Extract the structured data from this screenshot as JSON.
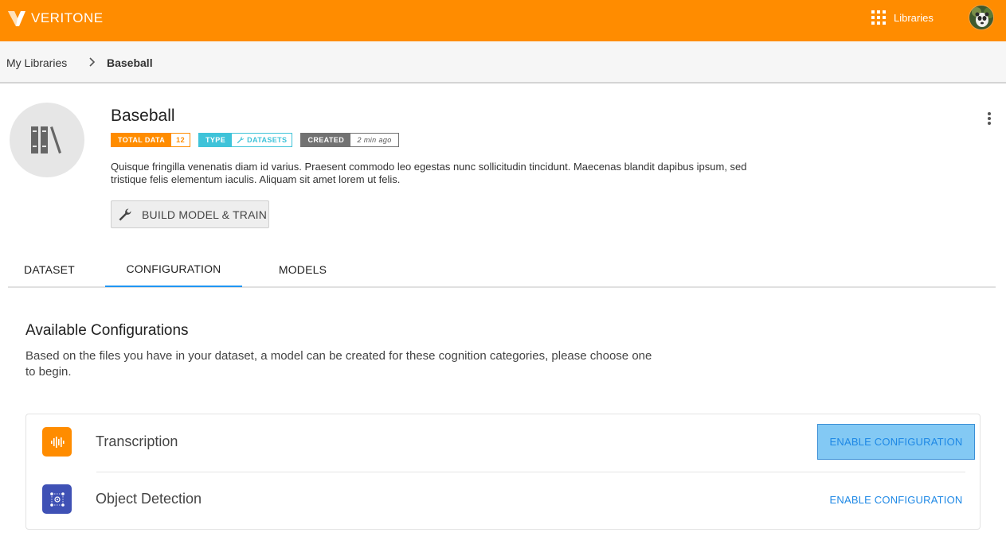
{
  "header": {
    "brand": "VERITONE",
    "apps_label": "Libraries",
    "icons": {
      "apps": "apps-grid-icon",
      "avatar": "user-avatar"
    }
  },
  "breadcrumb": {
    "root": "My Libraries",
    "current": "Baseball"
  },
  "library": {
    "title": "Baseball",
    "icon": "library-books-icon",
    "chips": {
      "total_data_key": "TOTAL DATA",
      "total_data_value": "12",
      "type_key": "TYPE",
      "type_value": "DATASETS",
      "created_key": "CREATED",
      "created_value": "2 min ago"
    },
    "description": "Quisque fringilla venenatis diam id varius. Praesent commodo leo egestas nunc sollicitudin tincidunt. Maecenas blandit dapibus ipsum, sed tristique felis elementum iaculis. Aliquam sit amet lorem ut felis.",
    "build_button": "BUILD MODEL & TRAIN"
  },
  "tabs": [
    {
      "label": "DATASET",
      "active": false
    },
    {
      "label": "CONFIGURATION",
      "active": true
    },
    {
      "label": "MODELS",
      "active": false
    }
  ],
  "section": {
    "title": "Available Configurations",
    "description": "Based on the files you have in your dataset, a model can be created for these cognition categories, please choose one to begin."
  },
  "configurations": [
    {
      "name": "Transcription",
      "action": "ENABLE CONFIGURATION",
      "icon": "audio-waveform-icon",
      "color": "#ff8c00"
    },
    {
      "name": "Object Detection",
      "action": "ENABLE CONFIGURATION",
      "icon": "object-detection-icon",
      "color": "#3f51b5"
    }
  ],
  "colors": {
    "brand": "#ff8c00",
    "accent": "#2196f3",
    "teal": "#3fc3d9"
  }
}
